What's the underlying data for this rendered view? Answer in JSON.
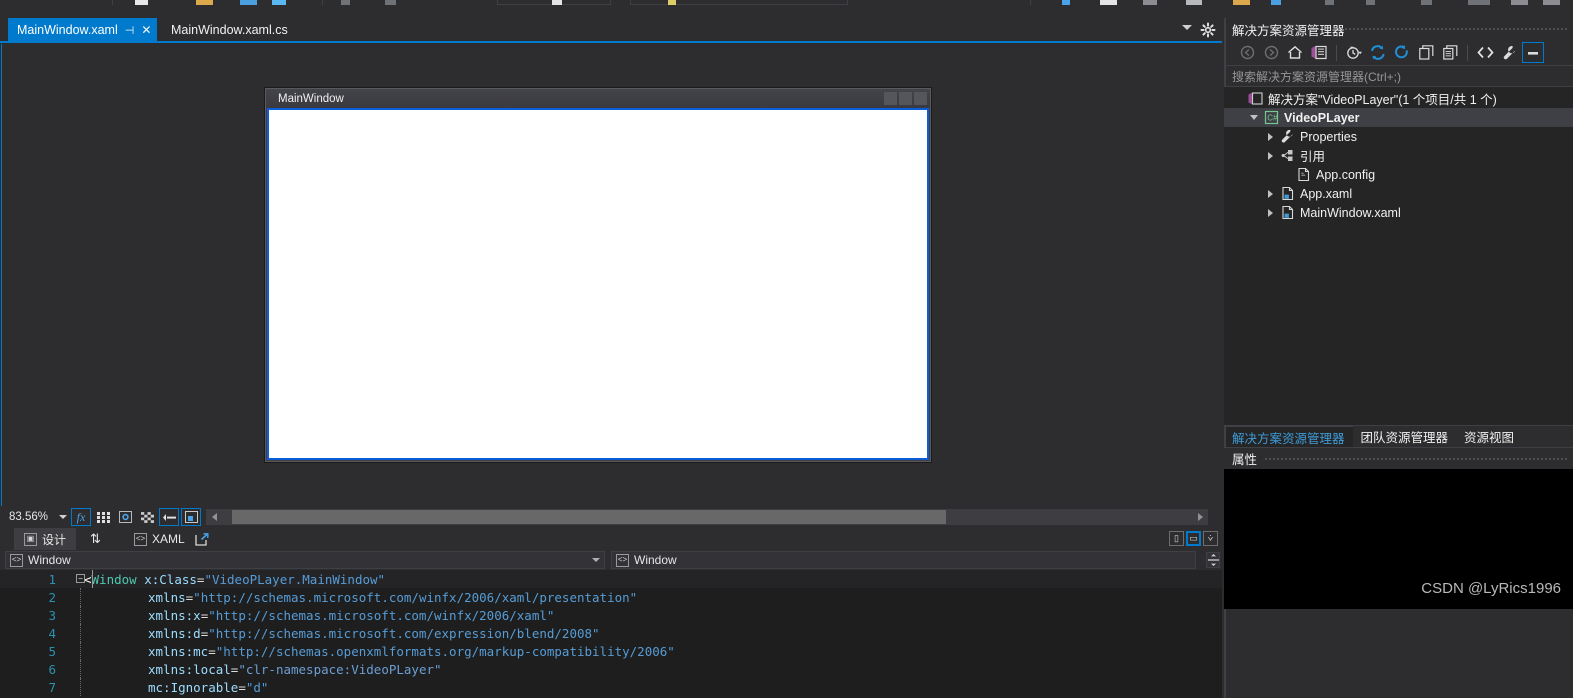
{
  "window": {
    "theme_accent": "#007acc",
    "background": "#2d2d30",
    "editor_background": "#1e1e1e"
  },
  "editor_tabs": {
    "active": {
      "label": "MainWindow.xaml",
      "pin": "⊣",
      "close": "✕"
    },
    "inactive": {
      "label": "MainWindow.xaml.cs"
    },
    "caret_icon": "chevron-down-icon",
    "gear_icon": "gear-icon"
  },
  "designer": {
    "preview_window_title": "MainWindow",
    "zoom_level": "83.56%",
    "toolbar_buttons": [
      {
        "name": "effects-button",
        "glyph": "fx",
        "boxed": true
      },
      {
        "name": "grid-button",
        "glyph": "▦",
        "boxed": false
      },
      {
        "name": "snap-grid-button",
        "glyph": "▩",
        "boxed": false
      },
      {
        "name": "transparency-button",
        "glyph": "▨",
        "boxed": false
      },
      {
        "name": "snap-to-gridlines-button",
        "glyph": "⊶",
        "boxed": true
      },
      {
        "name": "snap-to-snaplines-button",
        "glyph": "⊡",
        "boxed": true
      }
    ]
  },
  "view_tabs": {
    "design": "设计",
    "swap_icon": "swap-panes-icon",
    "xaml": "XAML",
    "popout_icon": "popout-icon",
    "split_buttons": [
      {
        "name": "vertical-split-button",
        "glyph": "▯",
        "selected": false
      },
      {
        "name": "horizontal-split-button",
        "glyph": "▭",
        "selected": true
      },
      {
        "name": "collapse-pane-button",
        "glyph": "⩒",
        "selected": false
      }
    ]
  },
  "code_navbar": {
    "left_scope": "Window",
    "right_scope": "Window",
    "splitter_icon": "split-editor-icon"
  },
  "code": {
    "lines": [
      {
        "n": "1",
        "fold": "−",
        "guide": false,
        "bar": true,
        "current": true,
        "indent": 0,
        "segments": [
          {
            "t": "<",
            "c": "k-ang"
          },
          {
            "t": "Window",
            "c": "k-tag"
          },
          {
            "t": " ",
            "c": "ctext"
          },
          {
            "t": "x:Class",
            "c": "k-attr"
          },
          {
            "t": "=",
            "c": "k-plain"
          },
          {
            "t": "\"VideoPLayer.MainWindow\"",
            "c": "k-str"
          }
        ]
      },
      {
        "n": "2",
        "fold": "",
        "guide": true,
        "bar": false,
        "current": false,
        "indent": 8,
        "segments": [
          {
            "t": "xmlns",
            "c": "k-attr"
          },
          {
            "t": "=",
            "c": "k-plain"
          },
          {
            "t": "\"http://schemas.microsoft.com/winfx/2006/xaml/presentation\"",
            "c": "k-str"
          }
        ]
      },
      {
        "n": "3",
        "fold": "",
        "guide": true,
        "bar": false,
        "current": false,
        "indent": 8,
        "segments": [
          {
            "t": "xmlns:x",
            "c": "k-attr"
          },
          {
            "t": "=",
            "c": "k-plain"
          },
          {
            "t": "\"http://schemas.microsoft.com/winfx/2006/xaml\"",
            "c": "k-str"
          }
        ]
      },
      {
        "n": "4",
        "fold": "",
        "guide": true,
        "bar": false,
        "current": false,
        "indent": 8,
        "segments": [
          {
            "t": "xmlns:d",
            "c": "k-attr"
          },
          {
            "t": "=",
            "c": "k-plain"
          },
          {
            "t": "\"http://schemas.microsoft.com/expression/blend/2008\"",
            "c": "k-str"
          }
        ]
      },
      {
        "n": "5",
        "fold": "",
        "guide": true,
        "bar": false,
        "current": false,
        "indent": 8,
        "segments": [
          {
            "t": "xmlns:mc",
            "c": "k-attr"
          },
          {
            "t": "=",
            "c": "k-plain"
          },
          {
            "t": "\"http://schemas.openxmlformats.org/markup-compatibility/2006\"",
            "c": "k-str"
          }
        ]
      },
      {
        "n": "6",
        "fold": "",
        "guide": true,
        "bar": false,
        "current": false,
        "indent": 8,
        "segments": [
          {
            "t": "xmlns:local",
            "c": "k-attr"
          },
          {
            "t": "=",
            "c": "k-plain"
          },
          {
            "t": "\"clr-namespace:VideoPLayer\"",
            "c": "k-str2"
          }
        ]
      },
      {
        "n": "7",
        "fold": "",
        "guide": true,
        "bar": false,
        "current": false,
        "indent": 8,
        "segments": [
          {
            "t": "mc:Ignorable",
            "c": "k-attr"
          },
          {
            "t": "=",
            "c": "k-plain"
          },
          {
            "t": "\"d\"",
            "c": "k-str"
          }
        ]
      }
    ]
  },
  "solution_explorer": {
    "title": "解决方案资源管理器",
    "search_placeholder": "搜索解决方案资源管理器(Ctrl+;)",
    "toolbar": [
      {
        "name": "back-icon",
        "glyph": "◀"
      },
      {
        "name": "forward-icon",
        "glyph": "▶"
      },
      {
        "name": "home-icon",
        "glyph": "⌂"
      },
      {
        "name": "solution-explorer-icon",
        "glyph": "▤"
      },
      {
        "name": "pending-changes-icon",
        "glyph": "◷"
      },
      {
        "name": "sync-icon",
        "glyph": "⇄"
      },
      {
        "name": "refresh-icon",
        "glyph": "⟳"
      },
      {
        "name": "collapse-all-icon",
        "glyph": "⊟"
      },
      {
        "name": "properties-window-icon",
        "glyph": "⧉"
      },
      {
        "name": "show-all-files-icon",
        "glyph": "<>"
      },
      {
        "name": "properties-wrench-icon",
        "glyph": "🔧"
      },
      {
        "name": "preview-selected-items-icon",
        "glyph": "▬"
      }
    ],
    "tree": [
      {
        "label": "解决方案\"VideoPLayer\"(1 个项目/共 1 个)",
        "icon": "solution-icon",
        "indent": 0,
        "expander": "none",
        "bold": false,
        "selected": false
      },
      {
        "label": "VideoPLayer",
        "icon": "csharp-project-icon",
        "indent": 1,
        "expander": "down",
        "bold": true,
        "selected": true
      },
      {
        "label": "Properties",
        "icon": "wrench-icon",
        "indent": 2,
        "expander": "right",
        "bold": false,
        "selected": false
      },
      {
        "label": "引用",
        "icon": "references-icon",
        "indent": 2,
        "expander": "right",
        "bold": false,
        "selected": false
      },
      {
        "label": "App.config",
        "icon": "config-file-icon",
        "indent": 3,
        "expander": "none",
        "bold": false,
        "selected": false
      },
      {
        "label": "App.xaml",
        "icon": "xaml-file-icon",
        "indent": 2,
        "expander": "right",
        "bold": false,
        "selected": false
      },
      {
        "label": "MainWindow.xaml",
        "icon": "xaml-file-icon",
        "indent": 2,
        "expander": "right",
        "bold": false,
        "selected": false
      }
    ]
  },
  "dock_tabs": [
    {
      "label": "解决方案资源管理器",
      "active": true
    },
    {
      "label": "团队资源管理器",
      "active": false
    },
    {
      "label": "资源视图",
      "active": false
    }
  ],
  "properties_panel": {
    "title": "属性"
  },
  "watermark": "CSDN @LyRics1996"
}
